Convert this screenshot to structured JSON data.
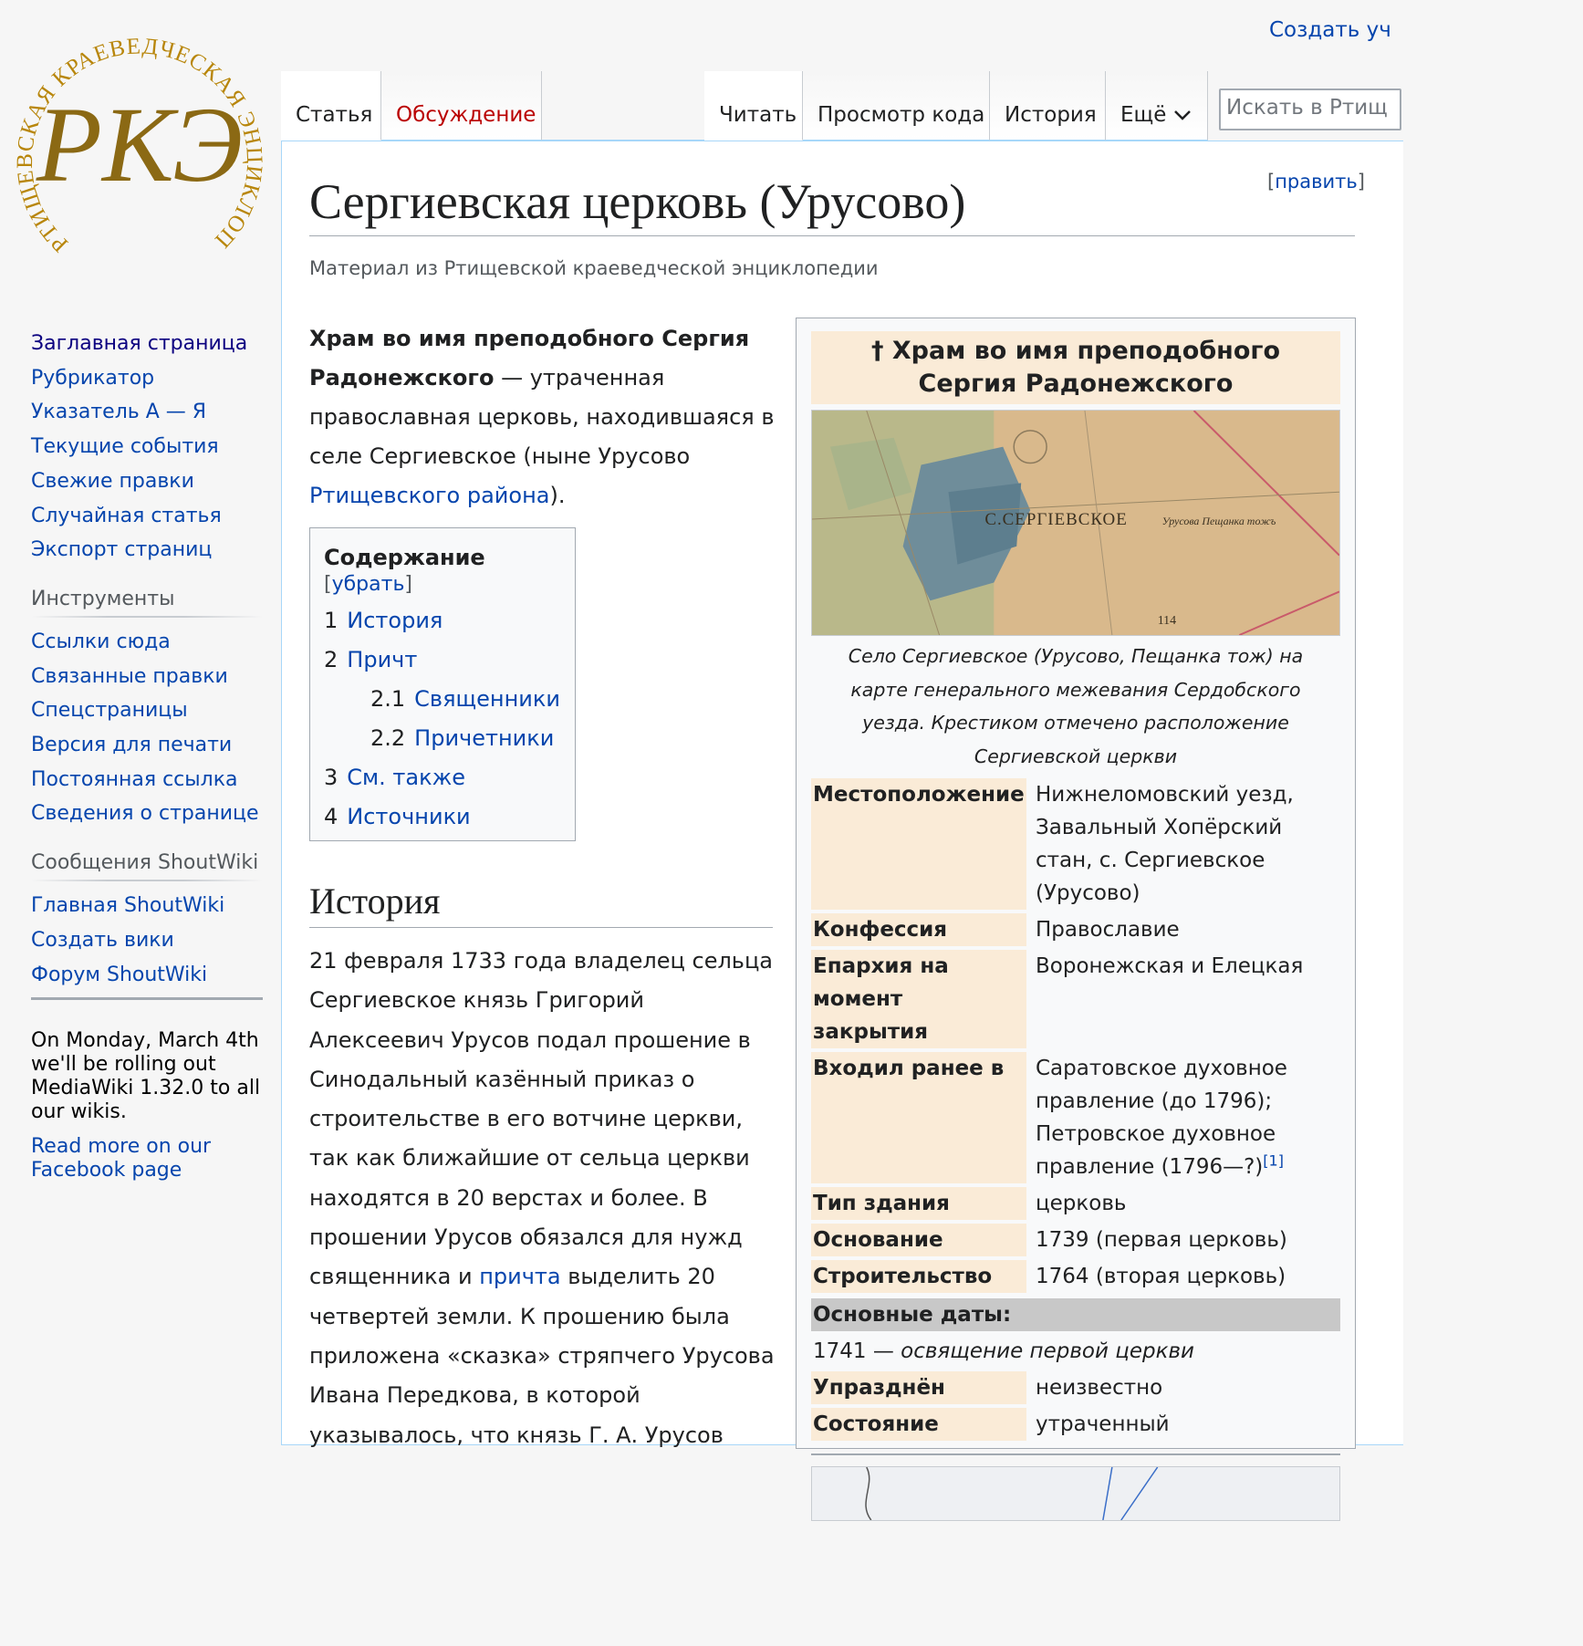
{
  "logo": {
    "ring_text": "РТИЩЕВСКАЯ КРАЕВЕДЧЕСКАЯ ЭНЦИКЛОПЕДИЯ",
    "monogram": "РКЭ",
    "color": "#b8860b"
  },
  "header": {
    "user_link": "Создать уч",
    "tabs_left": [
      "Статья",
      "Обсуждение"
    ],
    "tabs_right": [
      "Читать",
      "Просмотр кода",
      "История",
      "Ещё"
    ],
    "search_placeholder": "Искать в Ртищ"
  },
  "sidebar": {
    "nav": [
      "Заглавная страница",
      "Рубрикатор",
      "Указатель А — Я",
      "Текущие события",
      "Свежие правки",
      "Случайная статья",
      "Экспорт страниц"
    ],
    "tools_heading": "Инструменты",
    "tools": [
      "Ссылки сюда",
      "Связанные правки",
      "Спецстраницы",
      "Версия для печати",
      "Постоянная ссылка",
      "Сведения о странице"
    ],
    "shoutwiki_heading": "Сообщения ShoutWiki",
    "shoutwiki": [
      "Главная ShoutWiki",
      "Создать вики",
      "Форум ShoutWiki"
    ],
    "notice_text": "On Monday, March 4th we'll be rolling out MediaWiki 1.32.0 to all our wikis.",
    "notice_link": "Read more on our Facebook page"
  },
  "article": {
    "edit_open": "[",
    "edit_label": "править",
    "edit_close": "]",
    "title": "Сергиевская церковь (Урусово)",
    "tagline": "Материал из Ртищевской краеведческой энциклопедии",
    "lead_bold": "Храм во имя преподобного Сергия Радонежского",
    "lead_text": " — утраченная православная церковь, находившаяся в селе Сергиевское (ныне Урусово ",
    "lead_link": "Ртищевского района",
    "lead_end": ").",
    "toc": {
      "title": "Содержание",
      "toggle_open": " [",
      "toggle": "убрать",
      "toggle_close": "]",
      "items": [
        {
          "num": "1",
          "label": "История"
        },
        {
          "num": "2",
          "label": "Причт"
        },
        {
          "num": "2.1",
          "label": "Священники"
        },
        {
          "num": "2.2",
          "label": "Причетники"
        },
        {
          "num": "3",
          "label": "См. также"
        },
        {
          "num": "4",
          "label": "Источники"
        }
      ]
    },
    "section_history": "История",
    "history_p1": "21 февраля 1733 года владелец сельца Сергиевское князь Григорий Алексеевич Урусов подал прошение в Синодальный казённый приказ о строительстве в его вотчине церкви, так как ближайшие от сельца церкви находятся в 20 верстах и более. В прошении Урусов обязался для нужд священника и ",
    "history_link": "причта",
    "history_p2": " выделить 20 четвертей земли. К прошению была приложена «сказка» стряпчего Урусова Ивана Передкова, в которой указывалось, что князь Г. А. Урусов"
  },
  "infobox": {
    "title": "† Храм во имя преподобного Сергия Радонежского",
    "map_label": "С.СЕРГІЕВСКОЕ",
    "map_label_small": "Урусова Пещанка тожъ",
    "map_number": "114",
    "caption": "Село Сергиевское (Урусово, Пещанка тож) на карте генерального межевания Сердобского уезда. Крестиком отмечено расположение Сергиевской церкви",
    "rows": [
      {
        "label": "Местоположение",
        "value": "Нижнеломовский уезд, Завальный Хопёрский стан, с. Сергиевское (Урусово)"
      },
      {
        "label": "Конфессия",
        "value": "Православие"
      },
      {
        "label": "Епархия на момент закрытия",
        "value": "Воронежская и Елецкая"
      },
      {
        "label": "Входил ранее в",
        "value": "Саратовское духовное правление (до 1796); Петровское духовное правление (1796—?)",
        "ref": "[1]"
      },
      {
        "label": "Тип здания",
        "value": "церковь"
      },
      {
        "label": "Основание",
        "value": "1739 (первая церковь)"
      },
      {
        "label": "Строительство",
        "value": "1764 (вторая церковь)"
      }
    ],
    "dates_heading": "Основные даты:",
    "date_year": "1741 — ",
    "date_event": "освящение первой церкви",
    "rows2": [
      {
        "label": "Упразднён",
        "value": "неизвестно"
      },
      {
        "label": "Состояние",
        "value": "утраченный"
      }
    ]
  }
}
